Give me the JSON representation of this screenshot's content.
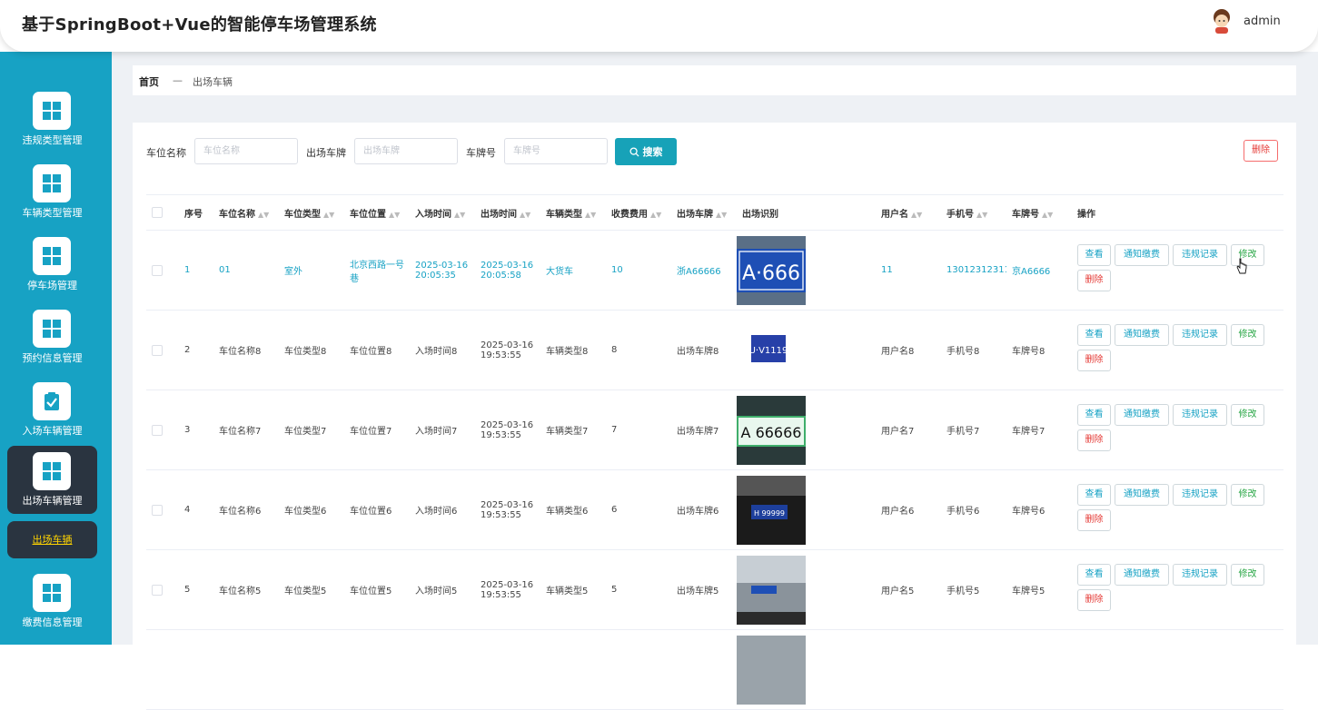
{
  "header": {
    "title": "基于SpringBoot+Vue的智能停车场管理系统",
    "username": "admin"
  },
  "sidebar": {
    "items": [
      {
        "label": "违规类型管理",
        "icon": "grid-icon"
      },
      {
        "label": "车辆类型管理",
        "icon": "grid-icon"
      },
      {
        "label": "停车场管理",
        "icon": "grid-icon"
      },
      {
        "label": "预约信息管理",
        "icon": "grid-icon"
      },
      {
        "label": "入场车辆管理",
        "icon": "clipboard-check-icon"
      },
      {
        "label": "出场车辆管理",
        "icon": "grid-icon"
      },
      {
        "label": "缴费信息管理",
        "icon": "grid-icon"
      }
    ],
    "active_sub": "出场车辆"
  },
  "breadcrumb": {
    "home": "首页",
    "separator": "—",
    "current": "出场车辆"
  },
  "search": {
    "field1_label": "车位名称",
    "field1_placeholder": "车位名称",
    "field2_label": "出场车牌",
    "field2_placeholder": "出场车牌",
    "field3_label": "车牌号",
    "field3_placeholder": "车牌号",
    "button": "搜索",
    "delete_button": "删除"
  },
  "table": {
    "headers": [
      "序号",
      "车位名称",
      "车位类型",
      "车位位置",
      "入场时间",
      "出场时间",
      "车辆类型",
      "收费费用",
      "出场车牌",
      "出场识别",
      "用户名",
      "手机号",
      "车牌号",
      "操作"
    ],
    "rows": [
      {
        "no": "1",
        "name": "01",
        "type": "室外",
        "pos": "北京西路一号巷",
        "in": "2025-03-16 20:05:35",
        "out": "2025-03-16 20:05:58",
        "vtype": "大货车",
        "fee": "10",
        "plate": "浙A66666",
        "user": "11",
        "phone": "13012312311",
        "plateno": "京A6666"
      },
      {
        "no": "2",
        "name": "车位名称8",
        "type": "车位类型8",
        "pos": "车位位置8",
        "in": "入场时间8",
        "out": "2025-03-16 19:53:55",
        "vtype": "车辆类型8",
        "fee": "8",
        "plate": "出场车牌8",
        "user": "用户名8",
        "phone": "手机号8",
        "plateno": "车牌号8"
      },
      {
        "no": "3",
        "name": "车位名称7",
        "type": "车位类型7",
        "pos": "车位位置7",
        "in": "入场时间7",
        "out": "2025-03-16 19:53:55",
        "vtype": "车辆类型7",
        "fee": "7",
        "plate": "出场车牌7",
        "user": "用户名7",
        "phone": "手机号7",
        "plateno": "车牌号7"
      },
      {
        "no": "4",
        "name": "车位名称6",
        "type": "车位类型6",
        "pos": "车位位置6",
        "in": "入场时间6",
        "out": "2025-03-16 19:53:55",
        "vtype": "车辆类型6",
        "fee": "6",
        "plate": "出场车牌6",
        "user": "用户名6",
        "phone": "手机号6",
        "plateno": "车牌号6"
      },
      {
        "no": "5",
        "name": "车位名称5",
        "type": "车位类型5",
        "pos": "车位位置5",
        "in": "入场时间5",
        "out": "2025-03-16 19:53:55",
        "vtype": "车辆类型5",
        "fee": "5",
        "plate": "出场车牌5",
        "user": "用户名5",
        "phone": "手机号5",
        "plateno": "车牌号5"
      }
    ],
    "ops": {
      "view": "查看",
      "notify": "通知缴费",
      "violation": "违规记录",
      "edit": "修改",
      "delete": "删除"
    }
  },
  "colors": {
    "sidebar": "#17a2c4",
    "active": "#2a3440",
    "accent": "#17a2b8",
    "danger": "#e53935",
    "edit": "#28a745"
  }
}
